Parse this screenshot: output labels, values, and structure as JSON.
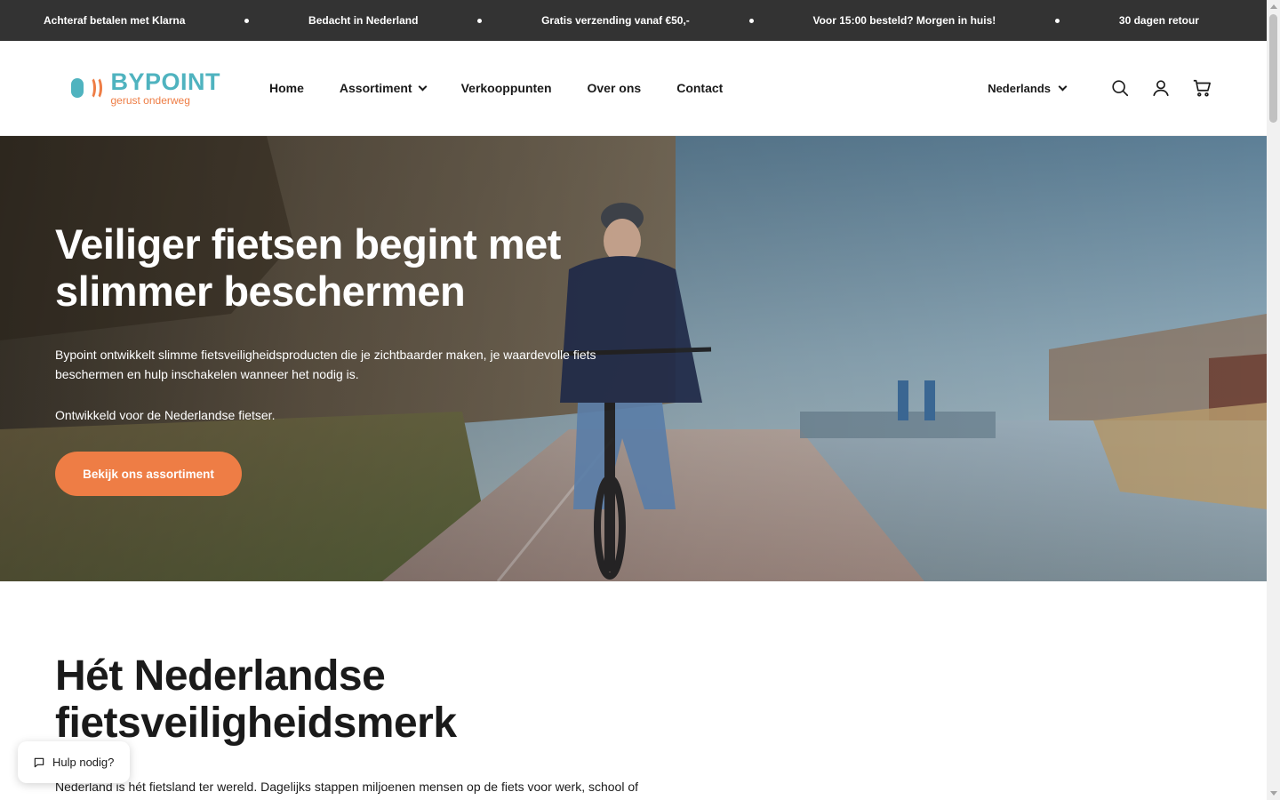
{
  "announcement": {
    "items": [
      "Achteraf betalen met Klarna",
      "Bedacht in Nederland",
      "Gratis verzending vanaf €50,-",
      "Voor 15:00 besteld? Morgen in huis!",
      "30 dagen retour"
    ]
  },
  "header": {
    "logo_name": "BYPOINT",
    "logo_tagline": "gerust onderweg",
    "nav": [
      {
        "label": "Home"
      },
      {
        "label": "Assortiment"
      },
      {
        "label": "Verkooppunten"
      },
      {
        "label": "Over ons"
      },
      {
        "label": "Contact"
      }
    ],
    "language": "Nederlands",
    "icons": [
      "search-icon",
      "account-icon",
      "cart-icon"
    ]
  },
  "hero": {
    "title_line1": "Veiliger fietsen begint met",
    "title_line2": "slimmer beschermen",
    "text": "Bypoint ontwikkelt slimme fietsveiligheidsproducten die je zichtbaarder maken, je waardevolle fiets beschermen en hulp inschakelen wanneer het nodig is.",
    "text2": "Ontwikkeld voor de Nederlandse fietser.",
    "cta_label": "Bekijk ons assortiment"
  },
  "section": {
    "title_line1": "Hét Nederlandse",
    "title_line2": "fietsveiligheidsmerk",
    "text": "Nederland is hét fietsland ter wereld. Dagelijks stappen miljoenen mensen op de fiets voor werk, school of"
  },
  "help_widget": {
    "label": "Hulp nodig?"
  },
  "colors": {
    "accent": "#ee7d45",
    "brand_teal": "#4fb3bf",
    "announcement_bg": "#333333"
  }
}
